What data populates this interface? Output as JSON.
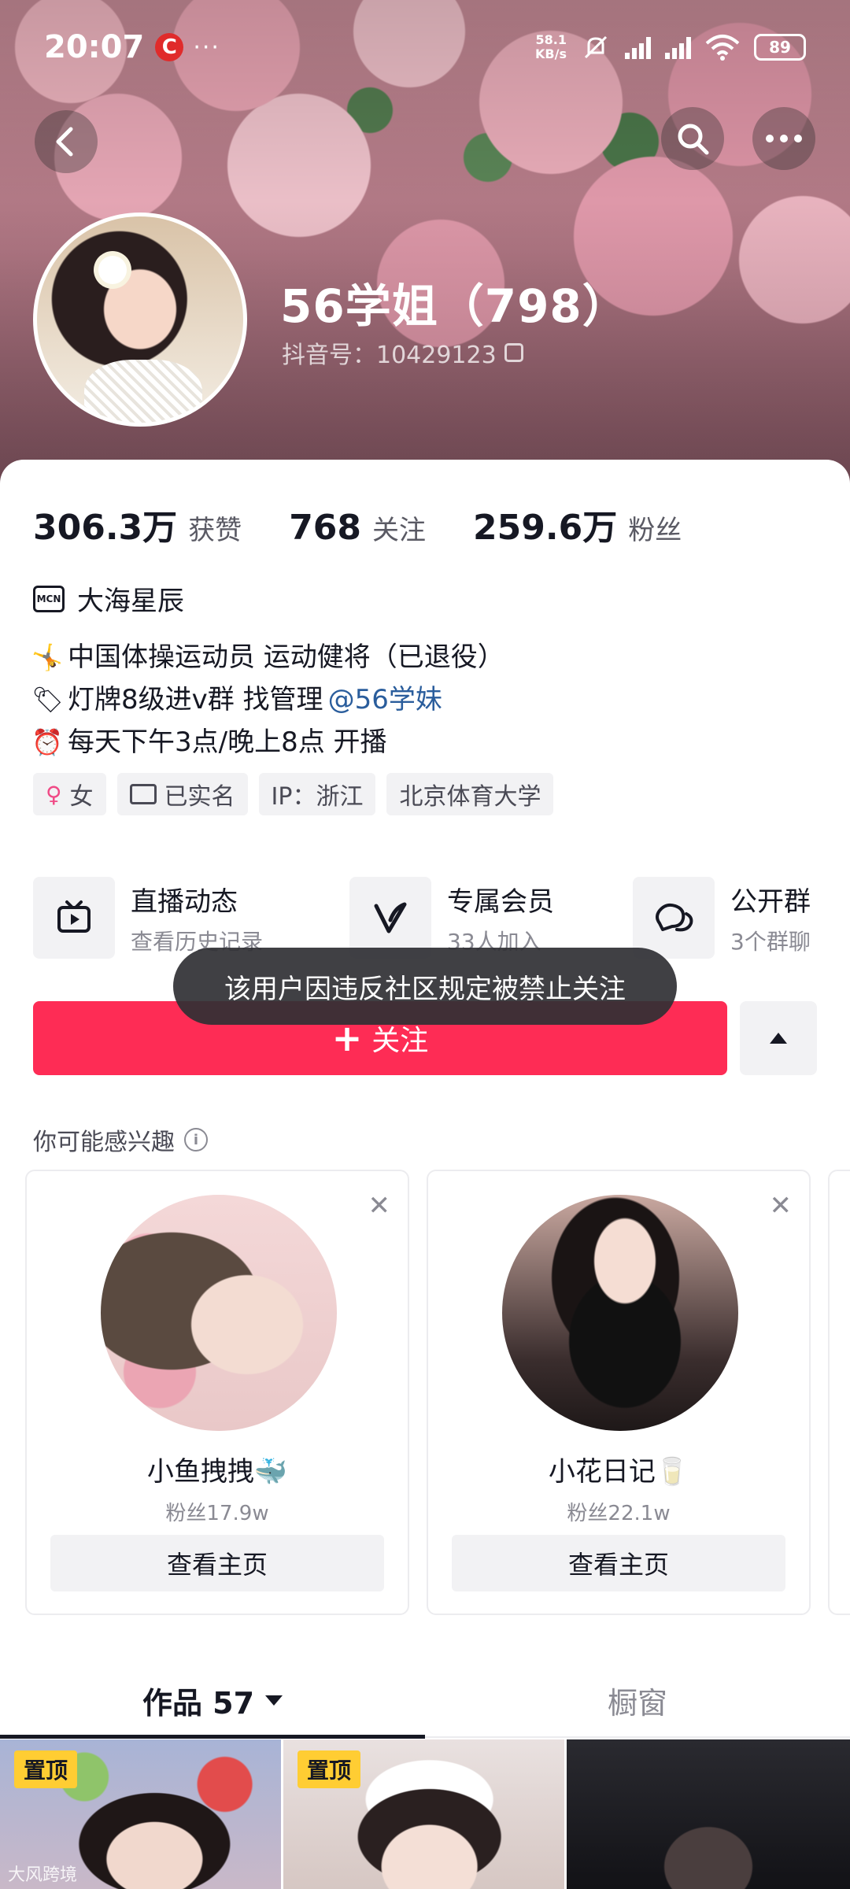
{
  "status_bar": {
    "time": "20:07",
    "app_badge": "C",
    "more_dots": "···",
    "net_speed_value": "58.1",
    "net_speed_unit": "KB/s",
    "battery": "89"
  },
  "profile": {
    "name": "56学姐（798）",
    "douyin_id": "抖音号：10429123"
  },
  "stats": [
    {
      "value": "306.3万",
      "label": "获赞"
    },
    {
      "value": "768",
      "label": "关注"
    },
    {
      "value": "259.6万",
      "label": "粉丝"
    }
  ],
  "mcn": {
    "badge": "MCN",
    "label": "大海星辰"
  },
  "bio": {
    "line1_emoji": "🤸",
    "line1": "中国体操运动员 运动健将（已退役）",
    "line2_emoji": "🏷",
    "line2": "灯牌8级进v群 找管理",
    "line2_mention": "@56学妹",
    "line3_emoji": "⏰",
    "line3": "每天下午3点/晚上8点 开播"
  },
  "tags": {
    "gender": "女",
    "verified": "已实名",
    "ip": "IP：浙江",
    "school": "北京体育大学"
  },
  "features": [
    {
      "title": "直播动态",
      "sub": "查看历史记录",
      "icon": "tv-icon"
    },
    {
      "title": "专属会员",
      "sub": "33人加入",
      "icon": "vip-icon"
    },
    {
      "title": "公开群",
      "sub": "3个群聊",
      "icon": "chat-icon"
    }
  ],
  "follow_button": {
    "label": "关注"
  },
  "toast": "该用户因违反社区规定被禁止关注",
  "recommendations": {
    "title": "你可能感兴趣",
    "items": [
      {
        "name": "小鱼拽拽🐳",
        "fans": "粉丝17.9w",
        "button": "查看主页"
      },
      {
        "name": "小花日记🥛",
        "fans": "粉丝22.1w",
        "button": "查看主页"
      }
    ]
  },
  "tabs": {
    "works": "作品 57",
    "shop": "橱窗"
  },
  "grid": {
    "pin_label": "置顶",
    "watermark": "大风跨境"
  },
  "colors": {
    "accent": "#fe2c55",
    "mention": "#2a5d9c",
    "pin": "#ffcd33"
  }
}
